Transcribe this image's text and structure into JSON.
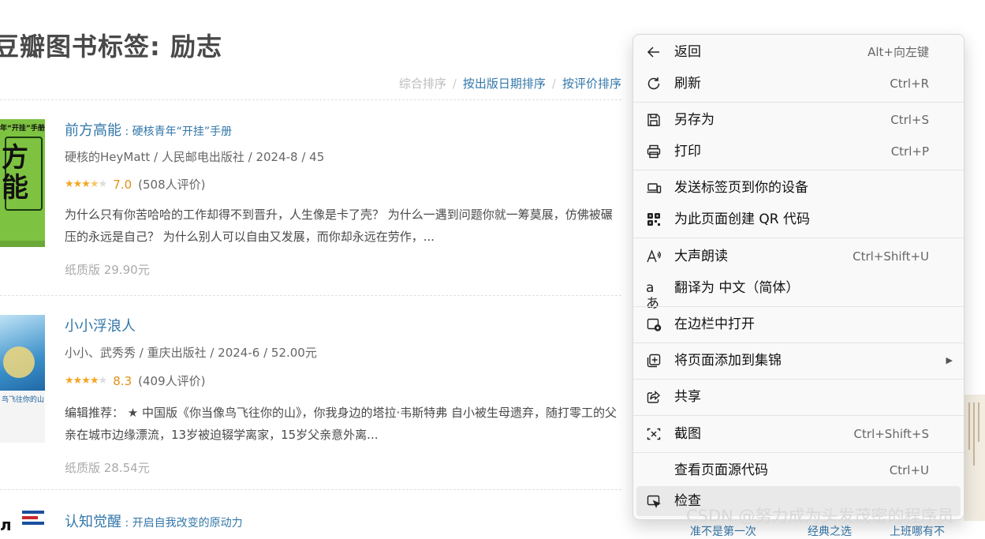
{
  "page": {
    "title": "豆瓣图书标签: 励志"
  },
  "sort": {
    "current": "综合排序",
    "sep1": "/",
    "by_date": "按出版日期排序",
    "sep2": "/",
    "by_rating": "按评价排序"
  },
  "books": [
    {
      "title": "前方高能",
      "subtitle": " : 硬核青年“开挂”手册",
      "pub": "硬核的HeyMatt / 人民邮电出版社 / 2024-8 / 45",
      "score": "7.0",
      "votes": "(508人评价)",
      "rating_stars": 3.5,
      "desc": "为什么只有你苦哈哈的工作却得不到晋升，人生像是卡了壳？ 为什么一遇到问题你就一筹莫展，仿佛被碾压的永远是自己？ 为什么别人可以自由又发展，而你却永远在劳作，...",
      "price": "纸质版 29.90元",
      "cover_text_top": "年“开挂”手册",
      "cover_text_main": "方\n能"
    },
    {
      "title": "小小浮浪人",
      "subtitle": "",
      "pub": "小小、武秀秀 / 重庆出版社 / 2024-6 / 52.00元",
      "score": "8.3",
      "votes": "(409人评价)",
      "rating_stars": 4,
      "desc": "编辑推荐： ★ 中国版《你当像鸟飞往你的山》，你我身边的塔拉·韦斯特弗 自小被生母遗弃，随打零工的父亲在城市边缘漂流，13岁被迫辍学离家，15岁父亲意外离...",
      "price": "纸质版 28.54元",
      "cover_text_top": "鸟飞往你的山"
    },
    {
      "title": "认知觉醒",
      "subtitle": " : 开启自我改变的原动力"
    }
  ],
  "context_menu": {
    "items": [
      {
        "icon": "back-arrow-icon",
        "label": "返回",
        "shortcut": "Alt+向左键"
      },
      {
        "icon": "refresh-icon",
        "label": "刷新",
        "shortcut": "Ctrl+R"
      },
      {
        "icon": "save-as-icon",
        "label": "另存为",
        "shortcut": "Ctrl+S"
      },
      {
        "icon": "print-icon",
        "label": "打印",
        "shortcut": "Ctrl+P"
      },
      {
        "icon": "send-to-device-icon",
        "label": "发送标签页到你的设备",
        "shortcut": ""
      },
      {
        "icon": "qr-code-icon",
        "label": "为此页面创建 QR 代码",
        "shortcut": ""
      },
      {
        "icon": "read-aloud-icon",
        "label": "大声朗读",
        "shortcut": "Ctrl+Shift+U"
      },
      {
        "icon": "translate-icon",
        "label": "翻译为 中文（简体）",
        "shortcut": ""
      },
      {
        "icon": "open-in-sidebar-icon",
        "label": "在边栏中打开",
        "shortcut": ""
      },
      {
        "icon": "add-to-collections-icon",
        "label": "将页面添加到集锦",
        "shortcut": "",
        "submenu": true
      },
      {
        "icon": "share-icon",
        "label": "共享",
        "shortcut": ""
      },
      {
        "icon": "screenshot-icon",
        "label": "截图",
        "shortcut": "Ctrl+Shift+S"
      },
      {
        "icon": "",
        "label": "查看页面源代码",
        "shortcut": "Ctrl+U"
      },
      {
        "icon": "inspect-icon",
        "label": "检查",
        "shortcut": "",
        "highlighted": true
      }
    ]
  },
  "watermark": "CSDN @努力成为头发茂密的程序员",
  "bottom_partial": [
    "准不是第一次",
    "经典之选",
    "上班哪有不"
  ],
  "colors": {
    "link": "#3377aa",
    "star": "#f5a623",
    "score": "#e09015",
    "menu_bg": "#f9f9f9",
    "menu_highlight": "#e9e9e9"
  }
}
